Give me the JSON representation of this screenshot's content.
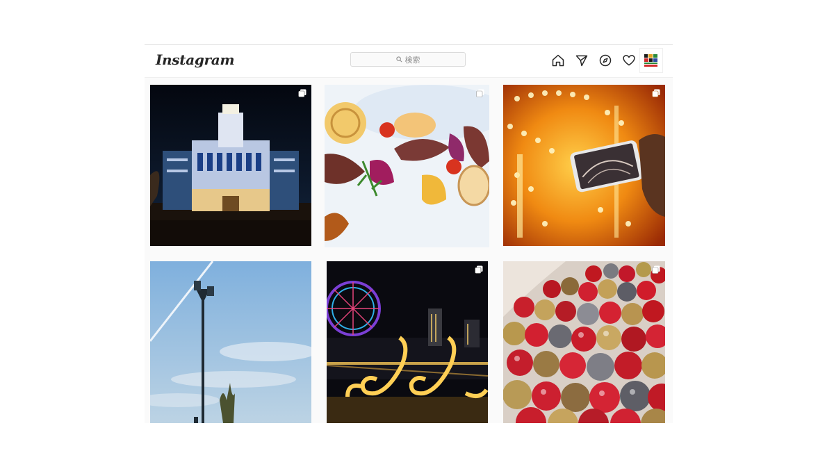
{
  "header": {
    "logo_text": "Instagram",
    "search": {
      "placeholder": "検索",
      "icon": "search-icon"
    },
    "nav_icons": [
      "home-icon",
      "direct-message-icon",
      "explore-icon",
      "activity-heart-icon"
    ],
    "avatar": "profile-avatar"
  },
  "posts": [
    {
      "name": "post-illuminated-building",
      "multi_image": true
    },
    {
      "name": "post-plated-dish",
      "multi_image": true
    },
    {
      "name": "post-carousel-lights",
      "multi_image": true
    },
    {
      "name": "post-street-lamp-sky",
      "multi_image": false
    },
    {
      "name": "post-ferris-wheel-night",
      "multi_image": true
    },
    {
      "name": "post-christmas-ornaments",
      "multi_image": true
    }
  ],
  "colors": {
    "text": "#262626",
    "muted": "#8e8e8e",
    "border": "#dbdbdb",
    "background": "#fafafa"
  }
}
